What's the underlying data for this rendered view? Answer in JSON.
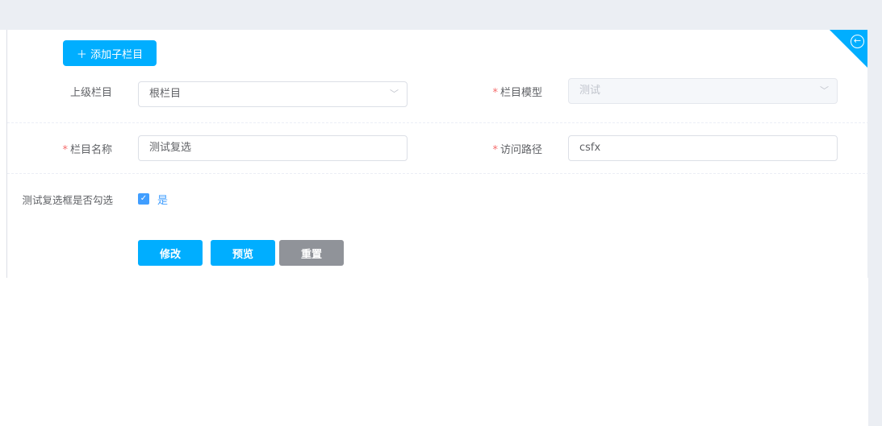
{
  "toolbar": {
    "add_label": "添加子栏目"
  },
  "form": {
    "parent": {
      "label": "上级栏目",
      "value": "根栏目"
    },
    "model": {
      "label": "栏目模型",
      "value": "测试"
    },
    "name": {
      "label": "栏目名称",
      "value": "测试复选"
    },
    "path": {
      "label": "访问路径",
      "value": "csfx"
    },
    "checkbox": {
      "label": "测试复选框是否勾选",
      "option": "是",
      "checked": true
    },
    "required_mark": "*"
  },
  "actions": {
    "modify": "修改",
    "preview": "预览",
    "reset": "重置"
  },
  "colors": {
    "primary": "#00aeff",
    "reset": "#909399",
    "checkbox": "#409eff"
  }
}
